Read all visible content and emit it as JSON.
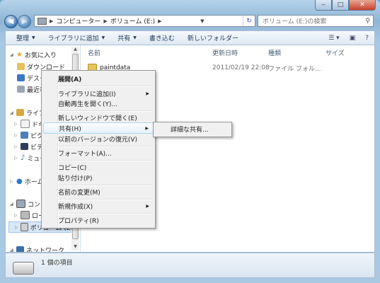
{
  "window": {
    "address": {
      "crumbs": [
        "コンピューター",
        "ボリューム (E:)"
      ],
      "search_placeholder": "ボリューム (E:)の検索"
    },
    "toolbar": {
      "items": [
        "整理",
        "ライブラリに追加",
        "共有",
        "書き込む",
        "新しいフォルダー"
      ]
    },
    "nav": {
      "favorites": "お気に入り",
      "fav_items": [
        "ダウンロード",
        "デスクトップ",
        "最近表示した場所"
      ],
      "libraries": "ライブラリ",
      "lib_items": [
        "ドキュメント",
        "ピクチャ",
        "ビデオ",
        "ミュージック"
      ],
      "homegroup": "ホームグループ",
      "computer": "コンピューター",
      "computer_items": [
        "ローカル ディスク (C:)",
        "ボリューム (E:)"
      ],
      "network": "ネットワーク"
    },
    "columns": [
      "名前",
      "更新日時",
      "種類",
      "サイズ"
    ],
    "files": [
      {
        "name": "paintdata",
        "modified": "2011/02/19 22:08",
        "type": "ファイル フォル..."
      }
    ],
    "status": "1 個の項目"
  },
  "context_menu": {
    "items": [
      "展開(A)",
      "ライブラリに追加(I)",
      "自動再生を開く(Y)...",
      "新しいウィンドウで開く(E)",
      "共有(H)",
      "以前のバージョンの復元(V)",
      "フォーマット(A)...",
      "コピー(C)",
      "貼り付け(P)",
      "名前の変更(M)",
      "新規作成(X)",
      "プロパティ(R)"
    ],
    "submenu": [
      "詳細な共有..."
    ]
  },
  "colors": {
    "accent": "#3b78b6",
    "highlight": "#e7f0fa"
  }
}
